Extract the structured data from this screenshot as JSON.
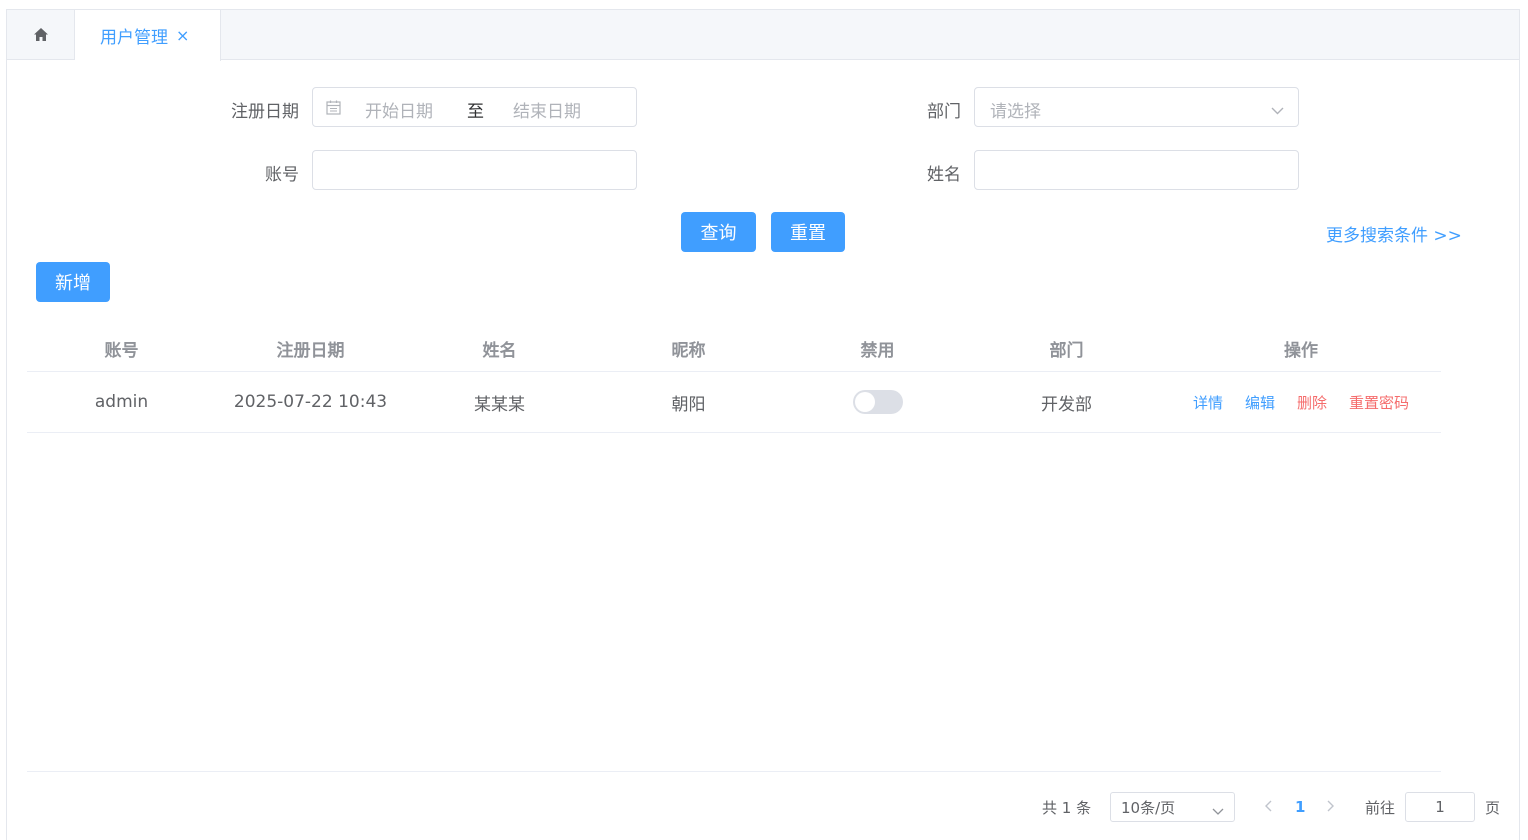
{
  "tabs": {
    "active_label": "用户管理",
    "close_glyph": "×"
  },
  "search": {
    "reg_date_label": "注册日期",
    "start_placeholder": "开始日期",
    "range_separator": "至",
    "end_placeholder": "结束日期",
    "dept_label": "部门",
    "dept_placeholder": "请选择",
    "account_label": "账号",
    "name_label": "姓名",
    "query_button": "查询",
    "reset_button": "重置",
    "more_link": "更多搜索条件 >>"
  },
  "toolbar": {
    "add_button": "新增"
  },
  "table": {
    "columns": [
      "账号",
      "注册日期",
      "姓名",
      "昵称",
      "禁用",
      "部门",
      "操作"
    ],
    "rows": [
      {
        "account": "admin",
        "reg_date": "2025-07-22 10:43",
        "name": "某某某",
        "nickname": "朝阳",
        "disabled": false,
        "dept": "开发部",
        "actions": {
          "detail": "详情",
          "edit": "编辑",
          "delete": "删除",
          "reset_pwd": "重置密码"
        }
      }
    ]
  },
  "pagination": {
    "total_text": "共 1 条",
    "page_size": "10条/页",
    "current_page": "1",
    "goto_label": "前往",
    "goto_value": "1",
    "page_unit": "页"
  },
  "colors": {
    "accent": "#409eff",
    "danger": "#f56c6c"
  }
}
